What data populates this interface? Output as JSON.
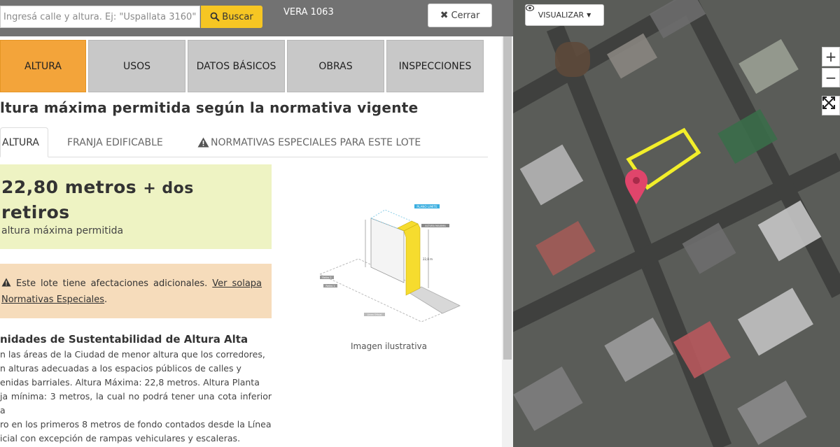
{
  "search": {
    "placeholder": "Ingresá calle y altura. Ej: \"Uspallata 3160\"",
    "button_label": "Buscar",
    "button_icon": "search-icon"
  },
  "address": "VERA 1063",
  "close_label": "Cerrar",
  "tabs": [
    {
      "label": "ALTURA",
      "active": true
    },
    {
      "label": "USOS"
    },
    {
      "label": "DATOS BÁSICOS"
    },
    {
      "label": "OBRAS"
    },
    {
      "label": "INSPECCIONES"
    }
  ],
  "title": "ltura máxima permitida según la normativa vigente",
  "subtabs": [
    {
      "label": "ALTURA",
      "active": true
    },
    {
      "label": "FRANJA EDIFICABLE"
    },
    {
      "label": "NORMATIVAS ESPECIALES PARA ESTE LOTE",
      "icon": "warning-icon"
    }
  ],
  "height": {
    "value": "22,80 metros",
    "suffix": "+ dos",
    "line2": "retiros",
    "caption": "altura máxima permitida"
  },
  "warning": {
    "text": "Este lote tiene afectaciones adicionales.",
    "link1": "Ver solapa",
    "link2": "Normativas Especiales",
    "end": "."
  },
  "illustration": {
    "caption": "Imagen ilustrativa",
    "labels": [
      "PLANO LIMITE",
      "ALTURA MAXIMA",
      "22,8 m",
      "Retiro 2",
      "Retiro 1",
      "Linea Oficial"
    ]
  },
  "uasa": {
    "title": "nidades de Sustentabilidad de Altura Alta",
    "lines": [
      "n las áreas de la Ciudad de menor altura que los corredores,",
      "n alturas adecuadas a los espacios públicos de calles y",
      "enidas barriales. Altura Máxima: 22,8 metros. Altura Planta",
      "ja mínima: 3 metros, la cual no podrá tener una cota inferior a",
      "ro en los primeros 8 metros de fondo contados desde la Línea",
      "icial con excepción de rampas vehiculares y escaleras."
    ]
  },
  "map": {
    "visualizar_label": "VISUALIZAR",
    "zoom_in": "+",
    "zoom_out": "−",
    "fullscreen": "⤢",
    "marker_color": "#e0456b",
    "highlight_color": "#f2ee2a"
  },
  "colors": {
    "active_tab": "#f3a43a",
    "tab": "#c8c8c8",
    "topbar": "#727272",
    "search_button": "#f6c623",
    "height_box": "#eef3c3",
    "warning_box": "#f6dcbb"
  }
}
